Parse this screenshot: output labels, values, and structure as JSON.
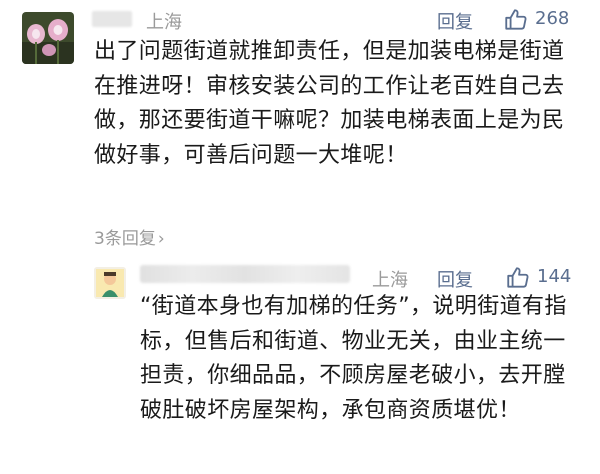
{
  "comment": {
    "location": "上海",
    "reply_label": "回复",
    "like_count": "268",
    "text": "出了问题街道就推卸责任，但是加装电梯是街道在推进呀！审核安装公司的工作让老百姓自己去做，那还要街道干嘛呢？加装电梯表面上是为民做好事，可善后问题一大堆呢！",
    "replies_toggle": "3条回复",
    "replies_chevron": "›"
  },
  "reply": {
    "location": "上海",
    "reply_label": "回复",
    "like_count": "144",
    "text": "“街道本身也有加梯的任务”，说明街道有指标，但售后和街道、物业无关，由业主统一担责，你细品品，不顾房屋老破小，去开膛破肚破坏房屋架构，承包商资质堪优！"
  },
  "colors": {
    "link": "#5a6e8f",
    "muted": "#9a9a9a",
    "text": "#1a1a1a"
  },
  "icons": [
    "thumbs-up-icon",
    "chevron-right-icon",
    "avatar"
  ]
}
